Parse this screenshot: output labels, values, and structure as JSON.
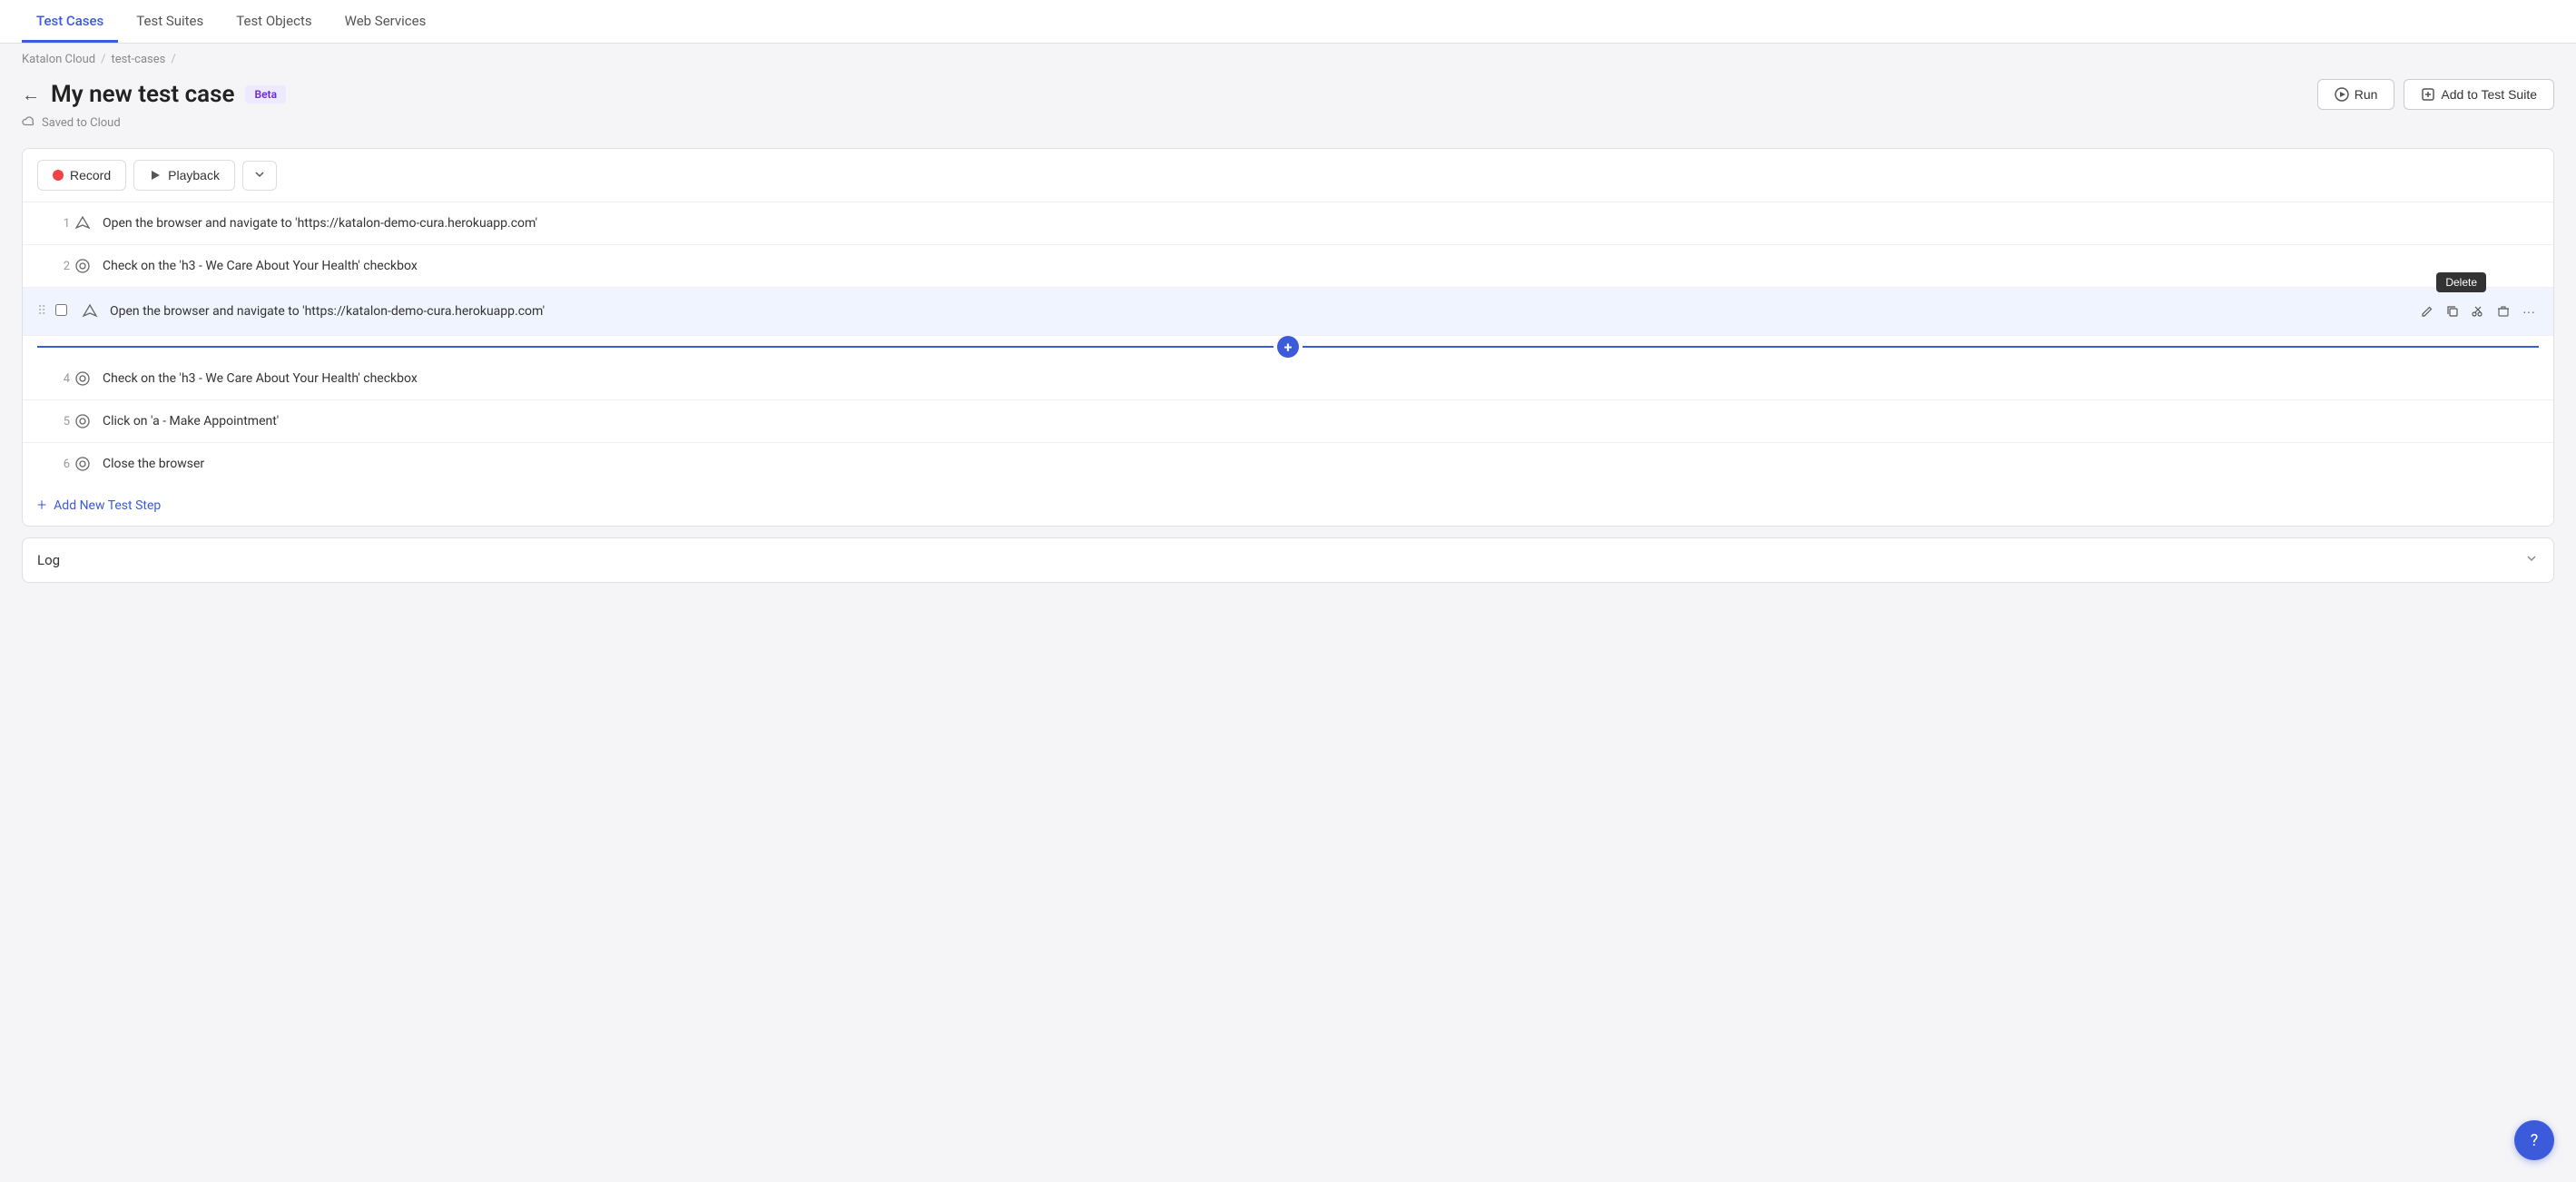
{
  "nav": {
    "tabs": [
      {
        "id": "test-cases",
        "label": "Test Cases",
        "active": true
      },
      {
        "id": "test-suites",
        "label": "Test Suites",
        "active": false
      },
      {
        "id": "test-objects",
        "label": "Test Objects",
        "active": false
      },
      {
        "id": "web-services",
        "label": "Web Services",
        "active": false
      }
    ]
  },
  "breadcrumb": {
    "items": [
      "Katalon Cloud",
      "test-cases"
    ]
  },
  "header": {
    "title": "My new test case",
    "badge": "Beta",
    "saved_label": "Saved to Cloud",
    "run_label": "Run",
    "add_suite_label": "Add to Test Suite"
  },
  "toolbar": {
    "record_label": "Record",
    "playback_label": "Playback"
  },
  "steps": [
    {
      "num": "1",
      "icon": "navigate",
      "text": "Open the browser and navigate to 'https://katalon-demo-cura.herokuapp.com'",
      "selected": false
    },
    {
      "num": "2",
      "icon": "click",
      "text": "Check on the 'h3 - We Care About Your Health' checkbox",
      "selected": false
    },
    {
      "num": "",
      "icon": "navigate",
      "text": "Open the browser and navigate to 'https://katalon-demo-cura.herokuapp.com'",
      "selected": true
    },
    {
      "num": "4",
      "icon": "click",
      "text": "Check on the 'h3 - We Care About Your Health' checkbox",
      "selected": false
    },
    {
      "num": "5",
      "icon": "click",
      "text": "Click on 'a - Make Appointment'",
      "selected": false
    },
    {
      "num": "6",
      "icon": "close",
      "text": "Close the browser",
      "selected": false
    }
  ],
  "add_step_label": "Add New Test Step",
  "log": {
    "title": "Log"
  },
  "tooltip": {
    "delete": "Delete"
  },
  "help_icon": "?"
}
